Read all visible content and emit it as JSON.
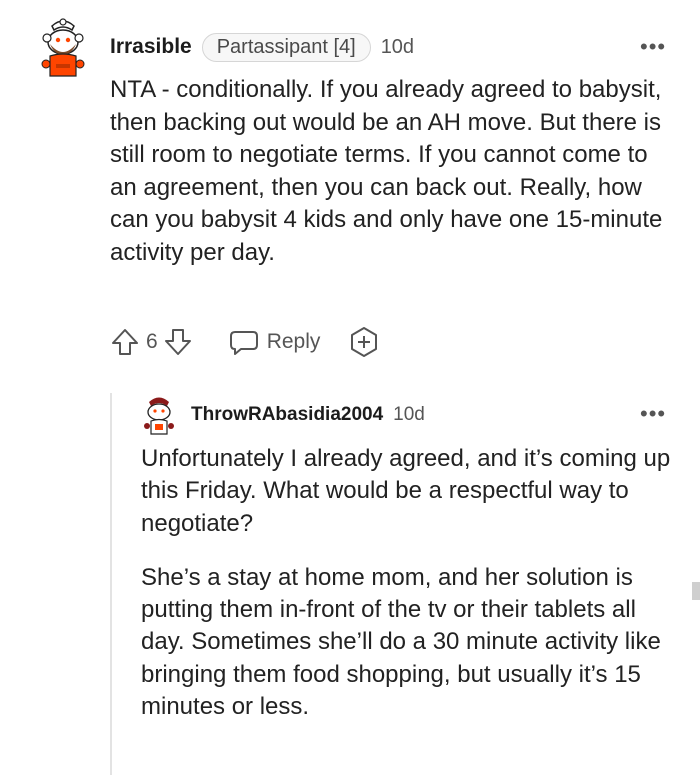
{
  "comment": {
    "username": "Irrasible",
    "flair": "Partassipant [4]",
    "age": "10d",
    "more_label": "•••",
    "body": "NTA - conditionally. If you already agreed to babysit, then backing out would be an AH move. But there is still room to negotiate terms. If you cannot come to an agreement, then you can back out. Really, how can you babysit 4 kids and only have one 15-minute activity per day.",
    "actions": {
      "vote_count": "6",
      "reply_label": "Reply",
      "upvote_icon": "arrow-up-icon",
      "downvote_icon": "arrow-down-icon",
      "reply_icon": "speech-bubble-icon",
      "award_icon": "award-plus-icon"
    }
  },
  "reply": {
    "username": "ThrowRAbasidia2004",
    "age": "10d",
    "more_label": "•••",
    "paragraphs": [
      "Unfortunately I already agreed, and it’s coming up this Friday. What would be a respectful way to negotiate?",
      "She’s a stay at home mom, and her solution is putting them in-front of the tv or their tablets all day. Sometimes she’ll do a 30 minute activity like bringing them food shopping, but usually it’s 15 minutes or less."
    ]
  },
  "colors": {
    "avatar_orange": "#ff4500",
    "text": "#1c1c1c",
    "muted": "#555555"
  }
}
